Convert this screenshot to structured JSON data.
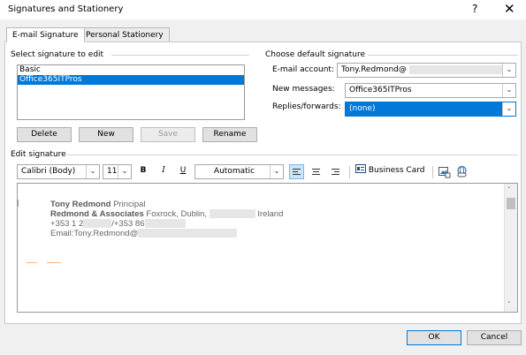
{
  "window": {
    "title": "Signatures and Stationery",
    "help_glyph": "?",
    "close_glyph": "✕"
  },
  "tabs": [
    {
      "label": "E-mail Signature",
      "active": true
    },
    {
      "label": "Personal Stationery",
      "active": false
    }
  ],
  "select_signature": {
    "group_label": "Select signature to edit",
    "items": [
      {
        "label": "Basic",
        "selected": false
      },
      {
        "label": "Office365ITPros",
        "selected": true
      }
    ],
    "buttons": {
      "delete": "Delete",
      "new": "New",
      "save": "Save",
      "rename": "Rename"
    }
  },
  "default_signature": {
    "group_label": "Choose default signature",
    "email_account_label": "E-mail account:",
    "email_account_value": "Tony.Redmond@",
    "new_messages_label": "New messages:",
    "new_messages_value": "Office365ITPros",
    "replies_label": "Replies/forwards:",
    "replies_value": "(none)"
  },
  "edit_signature": {
    "group_label": "Edit signature",
    "font": "Calibri (Body)",
    "size": "11",
    "bold_glyph": "B",
    "italic_glyph": "I",
    "underline_glyph": "U",
    "color": "Automatic",
    "business_card_label": "Business Card",
    "body": {
      "line1_name": "Tony Redmond",
      "line1_title": "Principal",
      "line2_company": "Redmond & Associates",
      "line2_location": "Foxrock, Dublin,",
      "line2_country": "Ireland",
      "line3_a": "+353 1 2",
      "line3_b": "/+353 86",
      "line4": "Email:Tony.Redmond@"
    }
  },
  "footer": {
    "ok": "OK",
    "cancel": "Cancel"
  },
  "colors": {
    "selection": "#0078d7",
    "dialog_bg": "#f0f0f0",
    "accent_orange": "#f4b183"
  }
}
